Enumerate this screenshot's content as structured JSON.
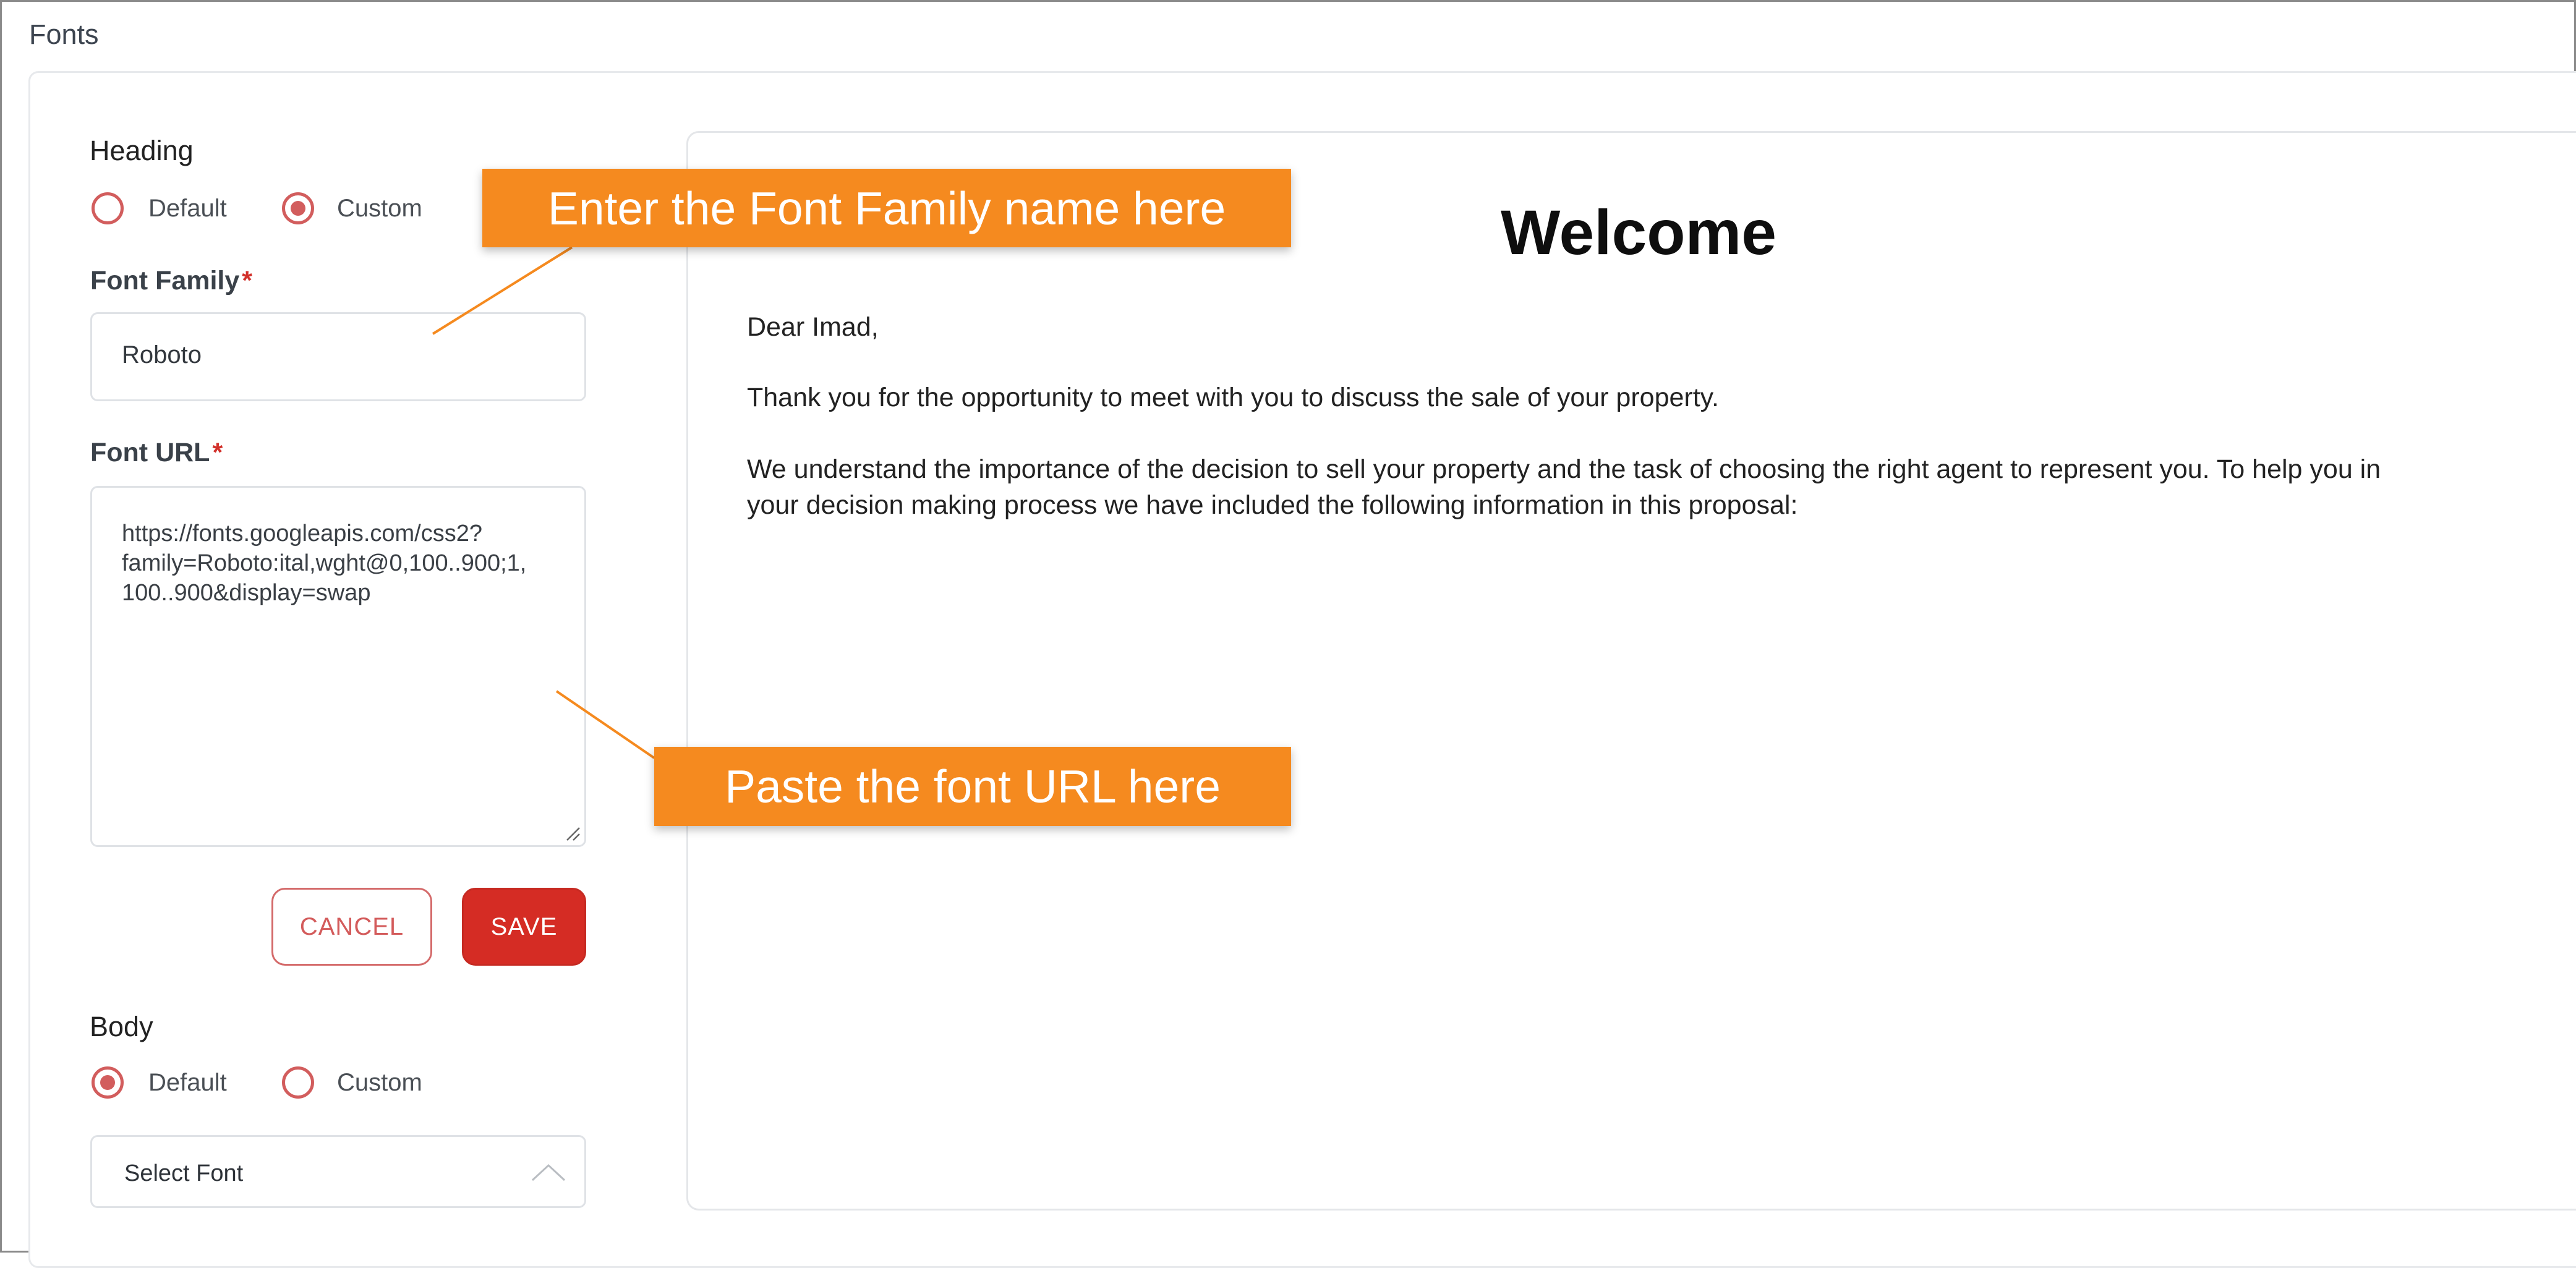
{
  "section": {
    "title": "Fonts"
  },
  "heading": {
    "label": "Heading",
    "options": [
      {
        "label": "Default",
        "selected": false
      },
      {
        "label": "Custom",
        "selected": true
      }
    ],
    "font_family_label": "Font Family",
    "font_family_value": "Roboto",
    "font_url_label": "Font URL",
    "font_url_value": "https://fonts.googleapis.com/css2?\nfamily=Roboto:ital,wght@0,100..900;1,\n100..900&display=swap",
    "required_mark": "*",
    "cancel_label": "CANCEL",
    "save_label": "SAVE"
  },
  "body_section": {
    "label": "Body",
    "options": [
      {
        "label": "Default",
        "selected": true
      },
      {
        "label": "Custom",
        "selected": false
      }
    ],
    "select_value": "Select Font"
  },
  "preview": {
    "title": "Welcome",
    "greeting": "Dear Imad,",
    "paragraph1": "Thank you for the opportunity to meet with you to discuss the sale of your property.",
    "paragraph2_line1": "We understand the importance of the decision to sell your property and the task of choosing the right agent to represent you. To help you in",
    "paragraph2_line2": "your decision making process we have included the following information in this proposal:"
  },
  "callouts": {
    "font_family": "Enter the Font Family name here",
    "font_url": "Paste the font URL here"
  },
  "colors": {
    "accent": "#d25d5d",
    "save": "#d52c24",
    "callout": "#f58a1f"
  }
}
